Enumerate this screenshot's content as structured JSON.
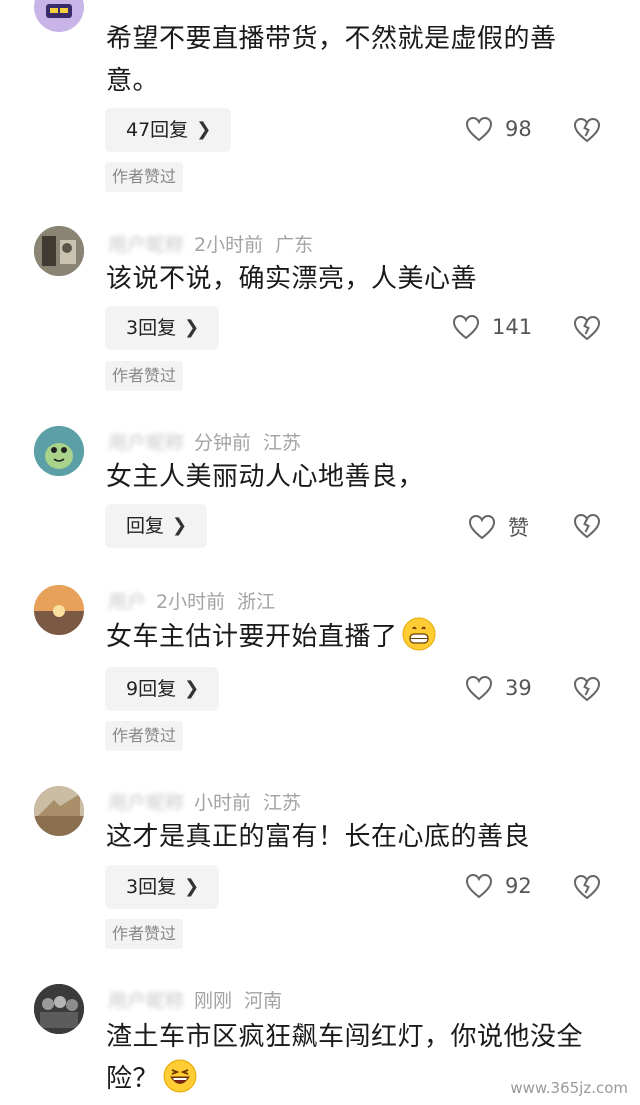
{
  "comments": [
    {
      "time": "",
      "location": "",
      "text": "希望不要直播带货，不然就是虚假的善意。",
      "reply_label": "47回复",
      "likes": "98",
      "badge": "作者赞过"
    },
    {
      "time": "2小时前",
      "location": "广东",
      "text": "该说不说，确实漂亮，人美心善",
      "reply_label": "3回复",
      "likes": "141",
      "badge": "作者赞过"
    },
    {
      "time": "分钟前",
      "location": "江苏",
      "text": "女主人美丽动人心地善良，",
      "reply_label": "回复",
      "likes": "赞",
      "badge": ""
    },
    {
      "time": "2小时前",
      "location": "浙江",
      "text": "女车主估计要开始直播了",
      "reply_label": "9回复",
      "likes": "39",
      "badge": "作者赞过"
    },
    {
      "time": "小时前",
      "location": "江苏",
      "text": "这才是真正的富有！长在心底的善良",
      "reply_label": "3回复",
      "likes": "92",
      "badge": "作者赞过"
    },
    {
      "time": "刚刚",
      "location": "河南",
      "text": "渣土车市区疯狂飙车闯红灯，你说他没全险？",
      "reply_label": "",
      "likes": "",
      "badge": ""
    }
  ],
  "icons": {
    "like": "heart-outline-icon",
    "dislike": "broken-heart-icon",
    "chevron": "chevron-right-icon",
    "grin_emoji": "grinning-face-icon",
    "laugh_emoji": "laughing-face-icon"
  },
  "watermark": "www.365jz.com"
}
